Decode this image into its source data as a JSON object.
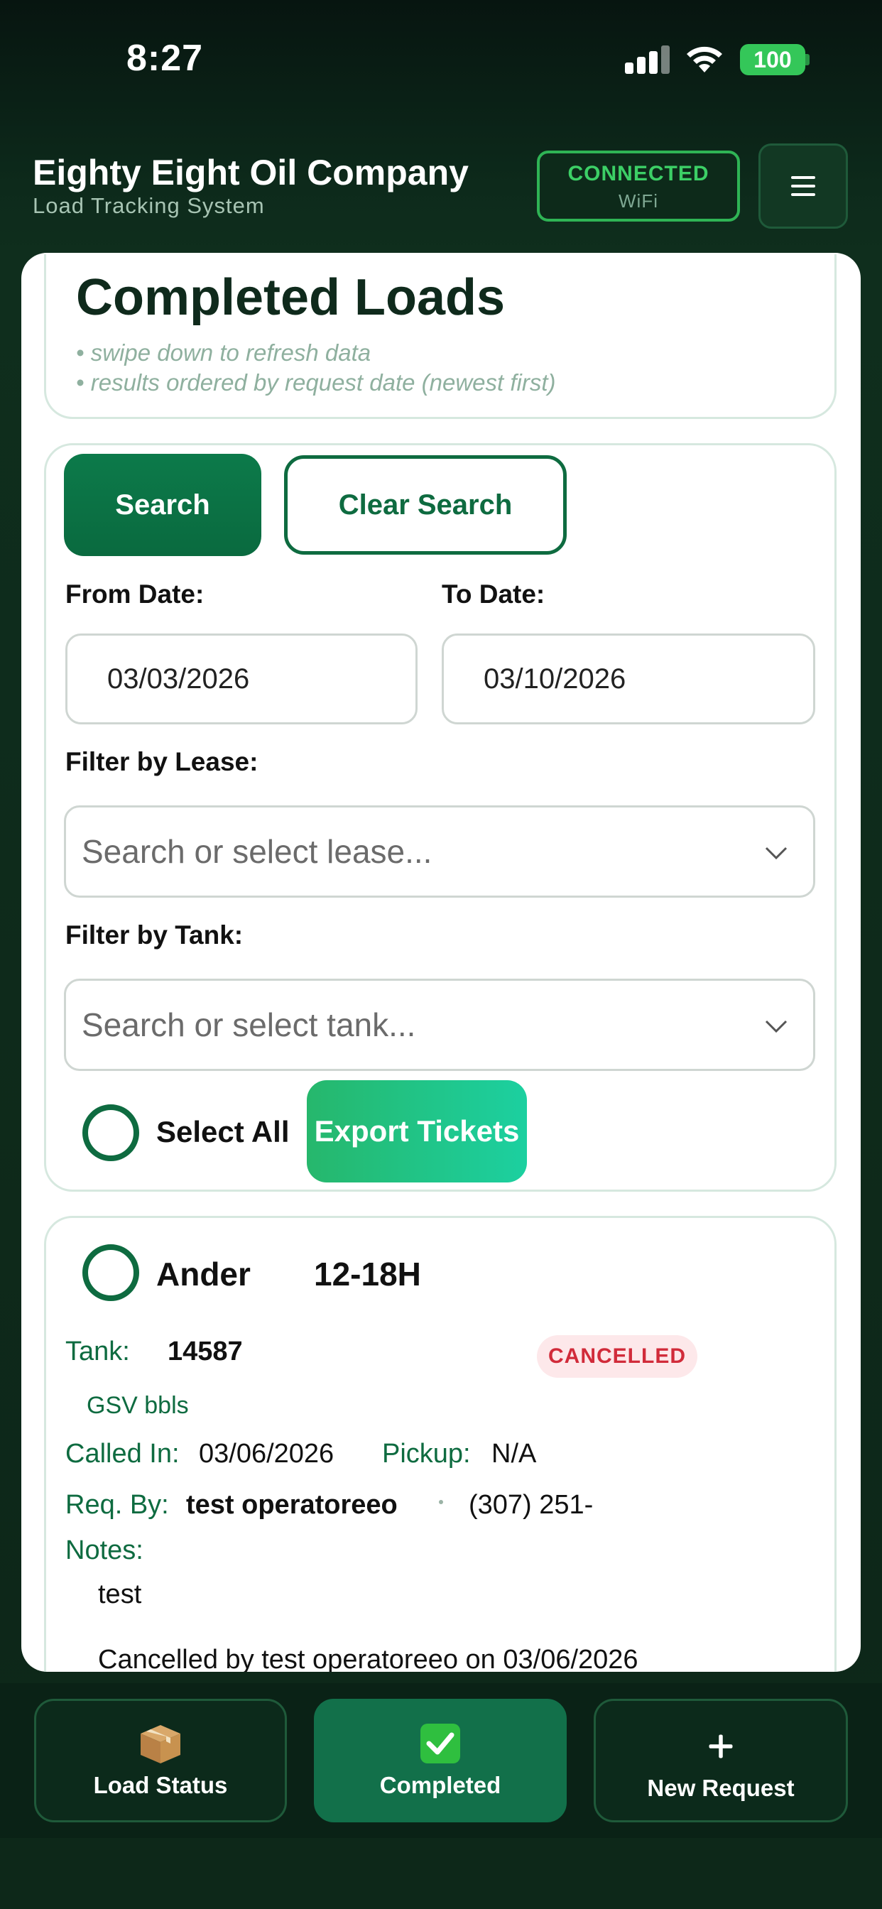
{
  "status_bar": {
    "time": "8:27",
    "battery": "100"
  },
  "header": {
    "title": "Eighty Eight Oil Company",
    "subtitle": "Load Tracking System",
    "connection_status": "CONNECTED",
    "connection_type": "WiFi",
    "menu_icon": "hamburger-icon"
  },
  "page": {
    "title": "Completed Loads",
    "hints": [
      "• swipe down to refresh data",
      "• results ordered by request date (newest first)"
    ]
  },
  "filters": {
    "search_label": "Search",
    "clear_label": "Clear Search",
    "from_date_label": "From Date:",
    "from_date_value": "03/03/2026",
    "to_date_label": "To Date:",
    "to_date_value": "03/10/2026",
    "lease_label": "Filter by Lease:",
    "lease_placeholder": "Search or select lease...",
    "tank_label": "Filter by Tank:",
    "tank_placeholder": "Search or select tank...",
    "select_all_label": "Select All",
    "export_label": "Export Tickets"
  },
  "load": {
    "lease": "Ander",
    "lease_number": "12-18H",
    "tank_label": "Tank:",
    "tank_value": "14587",
    "status": "CANCELLED",
    "gsv": "GSV bbls",
    "called_in_label": "Called In:",
    "called_in_value": "03/06/2026",
    "pickup_label": "Pickup:",
    "pickup_value": "N/A",
    "req_by_label": "Req. By:",
    "req_by_value": "test operatoreeo",
    "phone": "(307) 251-",
    "notes_label": "Notes:",
    "notes_value": "test",
    "cancel_note": "Cancelled by test operatoreeo on 03/06/2026"
  },
  "bottom_nav": [
    {
      "label": "Load Status",
      "icon": "package-icon"
    },
    {
      "label": "Completed",
      "icon": "check-box-icon"
    },
    {
      "label": "New Request",
      "icon": "plus-icon"
    }
  ],
  "colors": {
    "brand_green": "#0e6b40",
    "export_gradient_start": "#26b76c",
    "export_gradient_end": "#1cd0a0",
    "cancelled_text": "#d12b3a",
    "connected_text": "#3ccf66"
  }
}
